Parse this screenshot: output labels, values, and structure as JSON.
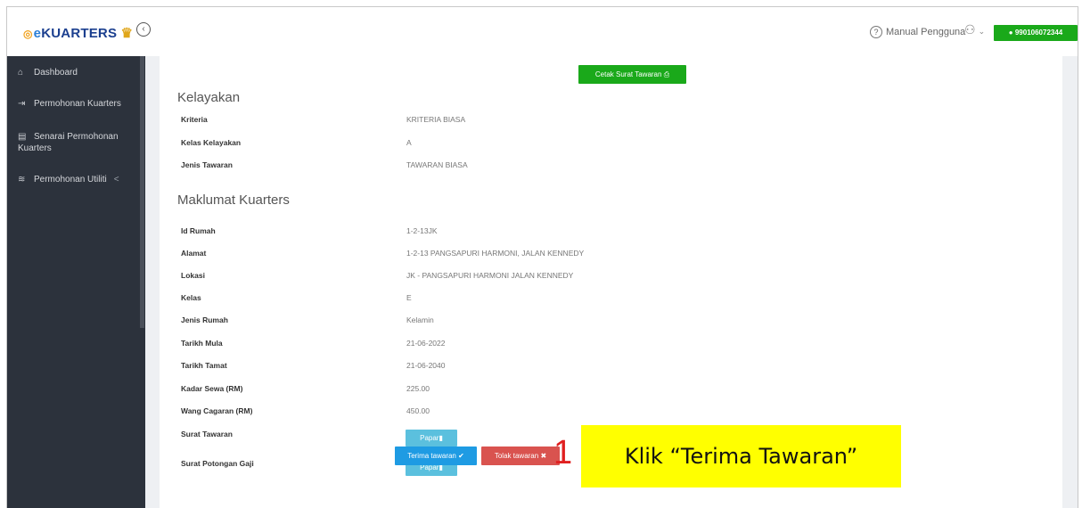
{
  "header": {
    "logo_prefix": "e",
    "logo_text": "KUARTERS",
    "manual_label": "Manual Pengguna",
    "user_id": "990106072344"
  },
  "sidebar": {
    "items": [
      {
        "label": "Dashboard",
        "icon": "home-icon"
      },
      {
        "label": "Permohonan Kuarters",
        "icon": "enter-icon"
      },
      {
        "label": "Senarai Permohonan Kuarters",
        "icon": "list-icon"
      },
      {
        "label": "Permohonan Utiliti",
        "icon": "layers-icon"
      }
    ]
  },
  "main": {
    "print_button": "Cetak Surat Tawaran",
    "sections": [
      {
        "title": "Kelayakan"
      },
      {
        "title": "Maklumat Kuarters"
      }
    ],
    "kelayakan": [
      {
        "label": "Kriteria",
        "value": "KRITERIA BIASA"
      },
      {
        "label": "Kelas Kelayakan",
        "value": "A"
      },
      {
        "label": "Jenis Tawaran",
        "value": "TAWARAN BIASA"
      }
    ],
    "kuarters": [
      {
        "label": "Id Rumah",
        "value": "1-2-13JK"
      },
      {
        "label": "Alamat",
        "value": "1-2-13 PANGSAPURI HARMONI, JALAN KENNEDY"
      },
      {
        "label": "Lokasi",
        "value": "JK - PANGSAPURI HARMONI JALAN KENNEDY"
      },
      {
        "label": "Kelas",
        "value": "E"
      },
      {
        "label": "Jenis Rumah",
        "value": "Kelamin"
      },
      {
        "label": "Tarikh Mula",
        "value": "21-06-2022"
      },
      {
        "label": "Tarikh Tamat",
        "value": "21-06-2040"
      },
      {
        "label": "Kadar Sewa (RM)",
        "value": "225.00"
      },
      {
        "label": "Wang Cagaran (RM)",
        "value": "450.00"
      }
    ],
    "documents": [
      {
        "label": "Surat Tawaran",
        "button": "Papar"
      },
      {
        "label": "Surat Potongan Gaji",
        "button": "Papar"
      }
    ],
    "accept_button": "Terima tawaran",
    "reject_button": "Tolak tawaran"
  },
  "annotation": {
    "number": "1",
    "text": "Klik “Terima Tawaran”",
    "color": "#ffff00"
  }
}
